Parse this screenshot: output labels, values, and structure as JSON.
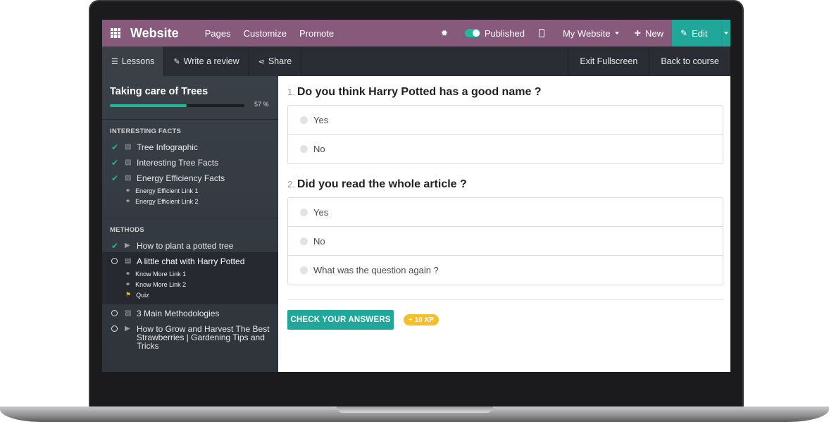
{
  "topbar": {
    "brand": "Website",
    "nav": [
      "Pages",
      "Customize",
      "Promote"
    ],
    "published_label": "Published",
    "website_label": "My Website",
    "new_label": "New",
    "edit_label": "Edit",
    "bar_color": "#875a7b",
    "edit_color": "#21a79a"
  },
  "subbar": {
    "lessons_label": "Lessons",
    "review_label": "Write a review",
    "share_label": "Share",
    "exit_label": "Exit Fullscreen",
    "back_label": "Back to course"
  },
  "sidebar": {
    "course_title": "Taking care of Trees",
    "progress_percent": 57,
    "progress_label": "57 %",
    "sections": [
      {
        "title": "INTERESTING FACTS",
        "lessons": [
          {
            "title": "Tree Infographic",
            "completed": true,
            "type_icon": "image-icon"
          },
          {
            "title": "Interesting Tree Facts",
            "completed": true,
            "type_icon": "image-icon"
          },
          {
            "title": "Energy Efficiency Facts",
            "completed": true,
            "type_icon": "image-icon",
            "links": [
              "Energy Efficient Link 1",
              "Energy Efficient Link 2"
            ]
          }
        ]
      },
      {
        "title": "METHODS",
        "lessons": [
          {
            "title": "How to plant a potted tree",
            "completed": true,
            "type_icon": "play-icon"
          },
          {
            "title": "A little chat with Harry Potted",
            "completed": false,
            "type_icon": "document-icon",
            "links": [
              "Know More Link 1",
              "Know More Link 2"
            ],
            "quiz": "Quiz"
          },
          {
            "title": "3 Main Methodologies",
            "completed": false,
            "type_icon": "pdf-icon"
          },
          {
            "title_lines": [
              "How to Grow and Harvest The Best",
              "Strawberries | Gardening Tips and",
              "Tricks"
            ],
            "completed": false,
            "type_icon": "play-icon"
          }
        ]
      }
    ]
  },
  "quiz": {
    "questions": [
      {
        "number": "1.",
        "text": "Do you think Harry Potted has a good name ?",
        "answers": [
          "Yes",
          "No"
        ]
      },
      {
        "number": "2.",
        "text": "Did you read the whole article ?",
        "answers": [
          "Yes",
          "No",
          "What was the question again ?"
        ]
      }
    ],
    "check_button": "CHECK YOUR ANSWERS",
    "xp_badge": "+ 10 XP",
    "accent_color": "#21a79a",
    "badge_color": "#f7be2a"
  }
}
